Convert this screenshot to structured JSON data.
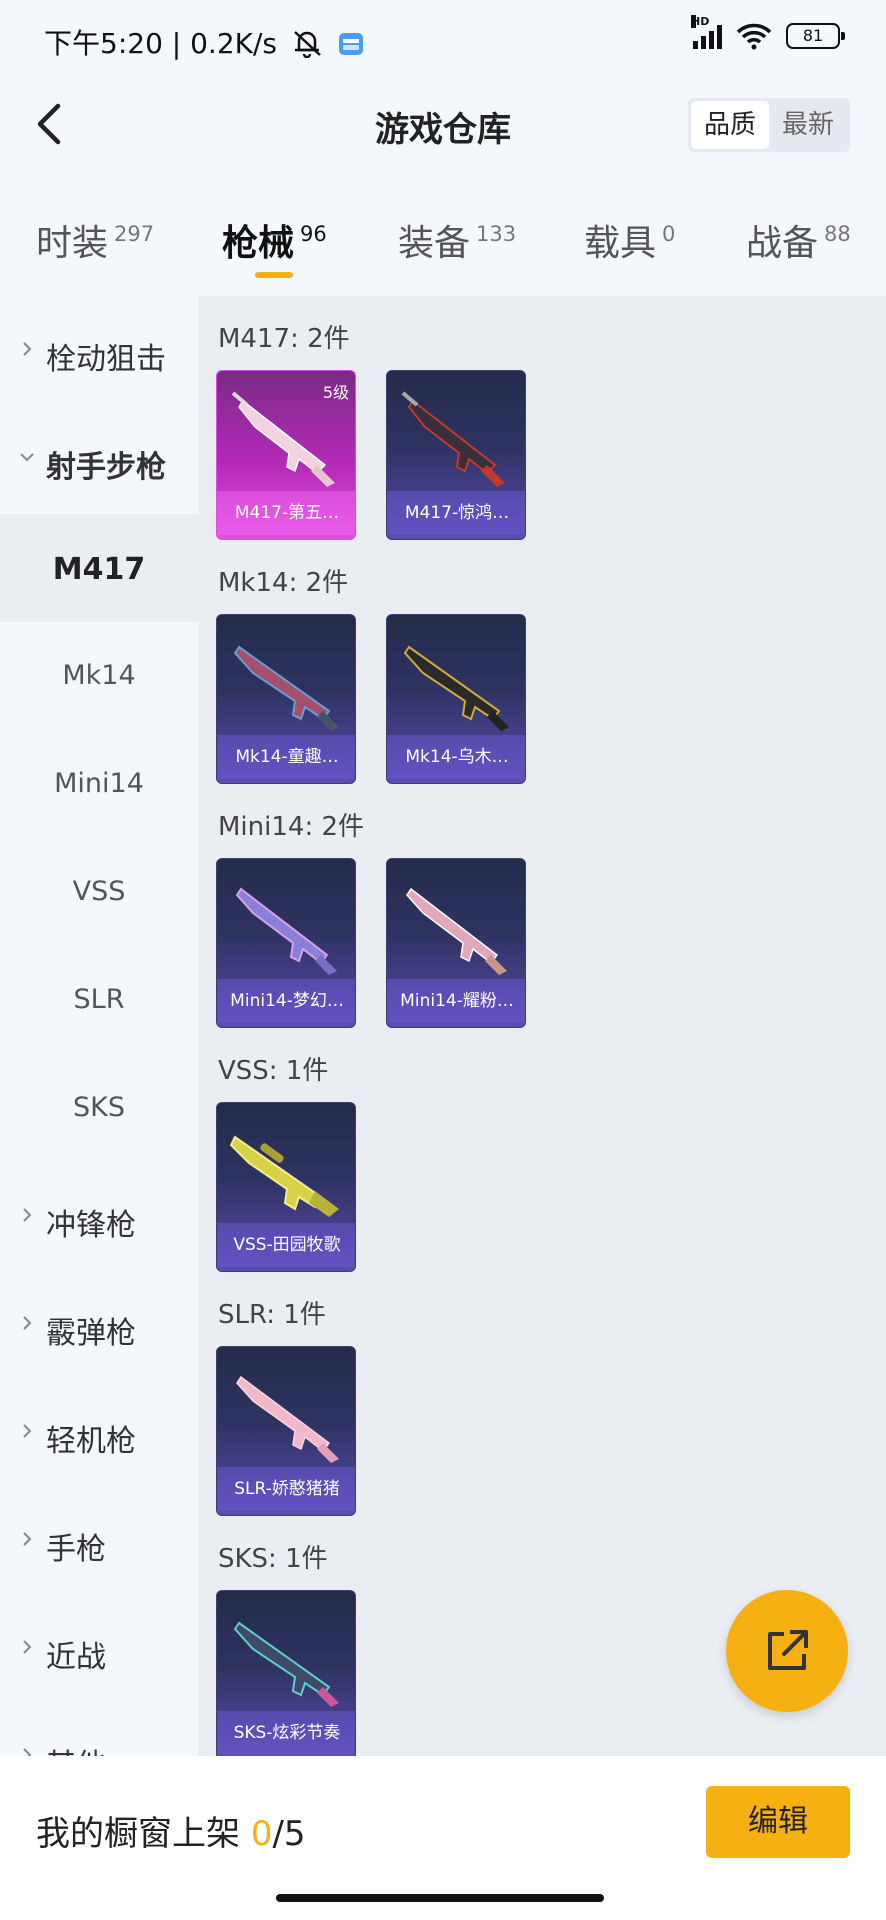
{
  "status_bar": {
    "time": "下午5:20 | 0.2K/s",
    "signal_label": "HD",
    "battery": "81"
  },
  "header": {
    "title": "游戏仓库",
    "sort_options": [
      "品质",
      "最新"
    ]
  },
  "tabs": [
    {
      "label": "时装",
      "count": "297"
    },
    {
      "label": "枪械",
      "count": "96"
    },
    {
      "label": "装备",
      "count": "133"
    },
    {
      "label": "载具",
      "count": "0"
    },
    {
      "label": "战备",
      "count": "88"
    }
  ],
  "sidebar": {
    "items": [
      {
        "label": "栓动狙击"
      },
      {
        "label": "射手步枪"
      },
      {
        "label": "M417"
      },
      {
        "label": "Mk14"
      },
      {
        "label": "Mini14"
      },
      {
        "label": "VSS"
      },
      {
        "label": "SLR"
      },
      {
        "label": "SKS"
      },
      {
        "label": "冲锋枪"
      },
      {
        "label": "霰弹枪"
      },
      {
        "label": "轻机枪"
      },
      {
        "label": "手枪"
      },
      {
        "label": "近战"
      },
      {
        "label": "其他"
      }
    ]
  },
  "groups": [
    {
      "title": "M417: 2件",
      "cards": [
        {
          "name": "M417-第五…",
          "level": "5级"
        },
        {
          "name": "M417-惊鸿…"
        }
      ]
    },
    {
      "title": "Mk14: 2件",
      "cards": [
        {
          "name": "Mk14-童趣…"
        },
        {
          "name": "Mk14-乌木…"
        }
      ]
    },
    {
      "title": "Mini14: 2件",
      "cards": [
        {
          "name": "Mini14-梦幻…"
        },
        {
          "name": "Mini14-耀粉…"
        }
      ]
    },
    {
      "title": "VSS: 1件",
      "cards": [
        {
          "name": "VSS-田园牧歌"
        }
      ]
    },
    {
      "title": "SLR: 1件",
      "cards": [
        {
          "name": "SLR-娇憨猪猪"
        }
      ]
    },
    {
      "title": "SKS: 1件",
      "cards": [
        {
          "name": "SKS-炫彩节奏"
        }
      ]
    }
  ],
  "bottom_bar": {
    "shelf_label": "我的橱窗上架",
    "shelf_current": "0",
    "shelf_total": "/5",
    "edit_label": "编辑"
  },
  "colors": {
    "accent": "#f6b012",
    "card_purple": "#2e3362",
    "card_legend": "#b42ab7"
  }
}
